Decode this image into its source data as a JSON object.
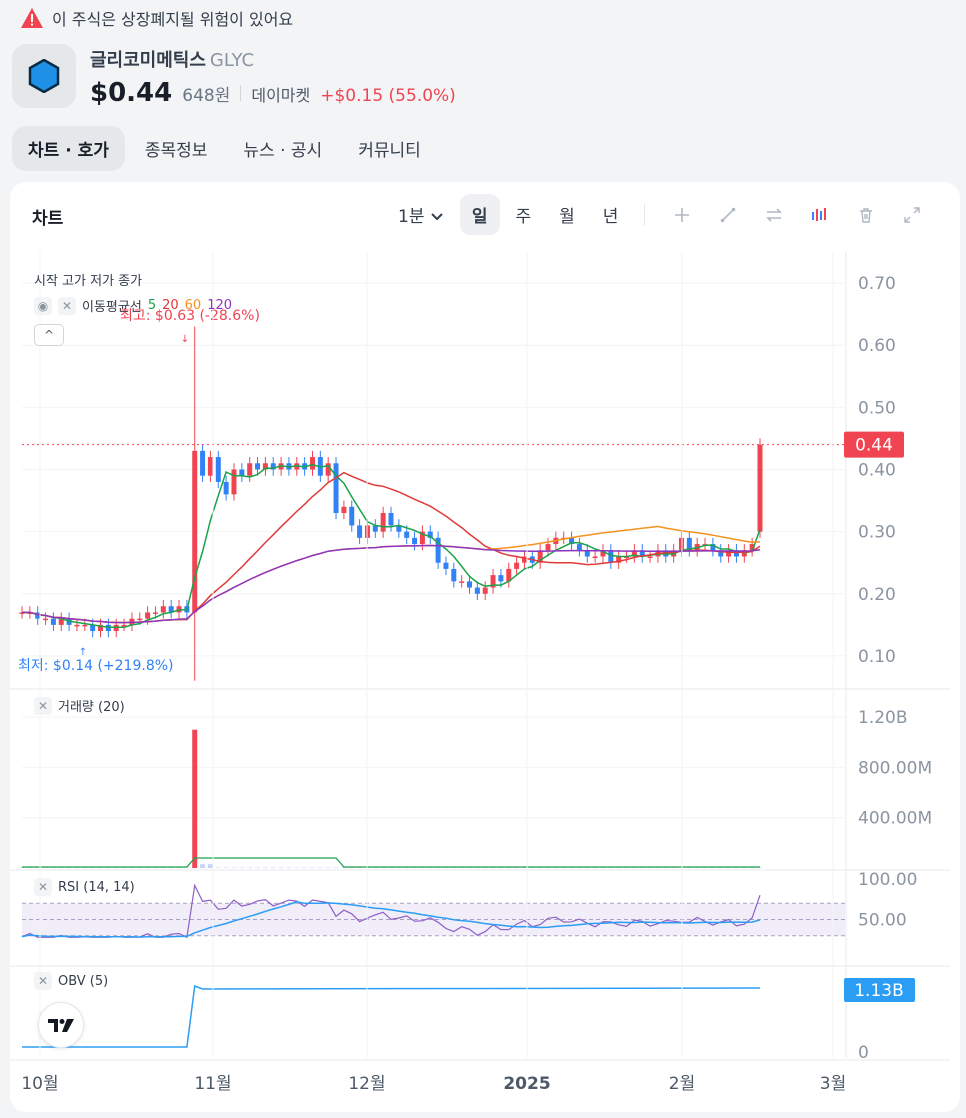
{
  "warning": {
    "text": "이 주식은 상장폐지될 위험이 있어요",
    "color": "#f04452"
  },
  "stock": {
    "name": "글리코미메틱스",
    "ticker": "GLYC",
    "price": "$0.44",
    "price_krw": "648원",
    "market": "데이마켓",
    "change": "+$0.15 (55.0%)",
    "logo_icon": "hexagon-logo-icon"
  },
  "tabs": [
    {
      "label": "차트 · 호가",
      "active": true
    },
    {
      "label": "종목정보",
      "active": false
    },
    {
      "label": "뉴스 · 공시",
      "active": false
    },
    {
      "label": "커뮤니티",
      "active": false
    }
  ],
  "chart_panel": {
    "title": "차트",
    "interval": "1분",
    "periods": [
      {
        "label": "일",
        "active": true
      },
      {
        "label": "주",
        "active": false
      },
      {
        "label": "월",
        "active": false
      },
      {
        "label": "년",
        "active": false
      }
    ],
    "tools": [
      "plus-icon",
      "draw-line-icon",
      "compare-icon",
      "indicator-icon",
      "trash-icon",
      "fullscreen-icon"
    ],
    "ohlc_label": "시작 고가 저가 종가",
    "ma_label": "이동평균선",
    "ma_periods": [
      "5",
      "20",
      "60",
      "120"
    ],
    "ma_colors": [
      "#1aa34a",
      "#e03a3a",
      "#f5921e",
      "#8d35c0"
    ],
    "high_note": "최고: $0.63 (-28.6%)",
    "low_note": "최저: $0.14 (+219.8%)",
    "volume_label": "거래량 (20)",
    "rsi_label": "RSI (14, 14)",
    "obv_label": "OBV (5)",
    "price_axis": [
      "0.70",
      "0.60",
      "0.50",
      "0.40",
      "0.30",
      "0.20",
      "0.10"
    ],
    "current_price_tag": "0.44",
    "volume_axis": [
      "1.20B",
      "800.00M",
      "400.00M"
    ],
    "rsi_axis": [
      "100.00",
      "50.00"
    ],
    "obv_axis_tag": "1.13B",
    "obv_axis_zero": "0",
    "x_axis": [
      "10월",
      "11월",
      "12월",
      "2025",
      "2월",
      "3월"
    ],
    "colors": {
      "up": "#f04452",
      "down": "#3182f6",
      "rsi": "#8d5fc7",
      "rsi_signal": "#2b9df4",
      "obv": "#2b9df4",
      "volume_ma": "#1aa34a"
    }
  },
  "chart_data": [
    {
      "type": "candlestick",
      "title": "",
      "x_start": "2024-10-01",
      "x_end": "2025-02-26",
      "ylim": [
        0.05,
        0.75
      ],
      "series_ohlc_notes": {
        "high": 0.63,
        "low": 0.14,
        "last": 0.44
      },
      "closes": [
        0.17,
        0.17,
        0.16,
        0.16,
        0.15,
        0.16,
        0.15,
        0.15,
        0.15,
        0.14,
        0.15,
        0.14,
        0.15,
        0.15,
        0.16,
        0.16,
        0.17,
        0.17,
        0.18,
        0.17,
        0.18,
        0.17,
        0.43,
        0.39,
        0.42,
        0.38,
        0.36,
        0.4,
        0.39,
        0.41,
        0.4,
        0.41,
        0.4,
        0.41,
        0.4,
        0.41,
        0.4,
        0.42,
        0.39,
        0.41,
        0.33,
        0.34,
        0.31,
        0.29,
        0.31,
        0.3,
        0.33,
        0.31,
        0.3,
        0.29,
        0.28,
        0.3,
        0.29,
        0.25,
        0.24,
        0.22,
        0.22,
        0.21,
        0.2,
        0.21,
        0.23,
        0.22,
        0.24,
        0.25,
        0.26,
        0.25,
        0.27,
        0.28,
        0.29,
        0.29,
        0.28,
        0.27,
        0.26,
        0.26,
        0.27,
        0.25,
        0.26,
        0.26,
        0.27,
        0.26,
        0.26,
        0.27,
        0.26,
        0.27,
        0.29,
        0.27,
        0.28,
        0.28,
        0.27,
        0.26,
        0.27,
        0.26,
        0.27,
        0.28,
        0.44
      ],
      "ma5_end": 0.31,
      "ma20_end": 0.28,
      "ma60_end": 0.27,
      "ma120_end": 0.25
    },
    {
      "type": "bar",
      "title": "거래량 (20)",
      "ylim": [
        0,
        1400000000
      ],
      "notes": "spike ~1.10B at 2024-10-30, otherwise near zero"
    },
    {
      "type": "line",
      "title": "RSI (14, 14)",
      "ylim": [
        0,
        100
      ],
      "bands": [
        30,
        50,
        70
      ],
      "last": 80
    },
    {
      "type": "line",
      "title": "OBV (5)",
      "last": 1130000000
    }
  ]
}
